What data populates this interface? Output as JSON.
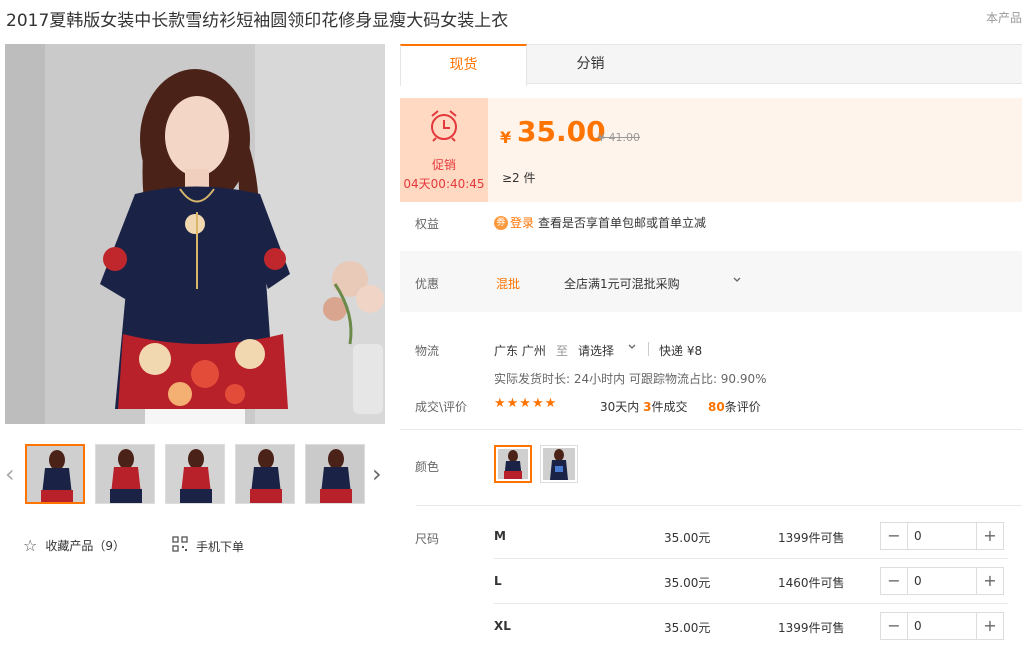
{
  "product": {
    "title": "2017夏韩版女装中长款雪纺衫短袖圆领印花修身显瘦大码女装上衣",
    "corner_note": "本产品"
  },
  "gallery": {
    "prev_arrow": "‹",
    "next_arrow": "›",
    "thumb_count": 5
  },
  "side_actions": {
    "favorite_label": "收藏产品（9）",
    "mobile_label": "手机下单"
  },
  "tabs": [
    {
      "label": "现货",
      "active": true
    },
    {
      "label": "分销",
      "active": false
    }
  ],
  "promo": {
    "label": "促销",
    "countdown": "04天00:40:45",
    "currency": "¥",
    "price": "35.00",
    "original_price": "¥ 41.00",
    "min_quantity": "≥2 件"
  },
  "benefits": {
    "label": "权益",
    "login_link": "登录",
    "text": "查看是否享首单包邮或首单立减"
  },
  "discount": {
    "label": "优惠",
    "tag": "混批",
    "text": "全店满1元可混批采购",
    "dropdown_icon": "chevron-down"
  },
  "logistics": {
    "label": "物流",
    "origin": "广东 广州",
    "to": "至",
    "destination": "请选择",
    "shipping": "快递 ¥8",
    "meta": "实际发货时长: 24小时内   可跟踪物流占比: 90.90%"
  },
  "rating": {
    "label": "成交\\评价",
    "stars": "★★★★★",
    "deals_prefix": "30天内",
    "deals_count": "3",
    "deals_suffix": "件成交",
    "review_count": "80",
    "review_suffix": "条评价"
  },
  "colors": {
    "label": "颜色",
    "options": 2
  },
  "sizes": {
    "label": "尺码",
    "rows": [
      {
        "name": "M",
        "price": "35.00元",
        "stock": "1399件可售",
        "qty": "0"
      },
      {
        "name": "L",
        "price": "35.00元",
        "stock": "1460件可售",
        "qty": "0"
      },
      {
        "name": "XL",
        "price": "35.00元",
        "stock": "1399件可售",
        "qty": "0"
      }
    ],
    "minus": "−",
    "plus": "+"
  },
  "colors_theme": {
    "accent": "#ff7300",
    "promo_bg": "#fff4ec",
    "promo_box": "#ffd9c2"
  }
}
